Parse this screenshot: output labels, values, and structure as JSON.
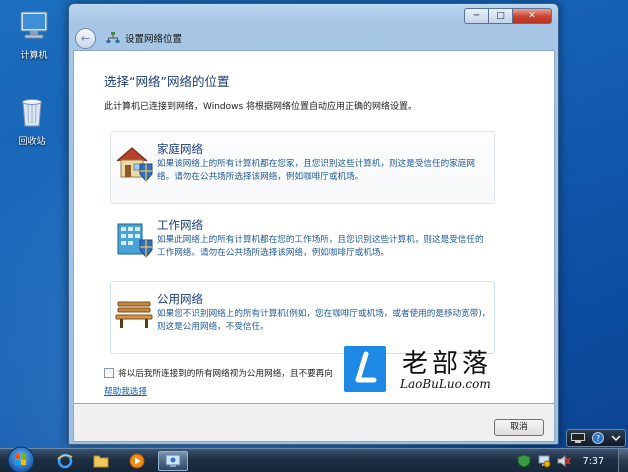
{
  "desktop": {
    "icons": [
      {
        "label": "计算机"
      },
      {
        "label": "回收站"
      }
    ]
  },
  "window": {
    "title": "设置网络位置",
    "controls": {
      "minimize": "─",
      "maximize": "□",
      "close": "✕"
    },
    "heading": "选择“网络”网络的位置",
    "description": "此计算机已连接到网络，Windows 将根据网络位置自动应用正确的网络设置。",
    "options": [
      {
        "title": "家庭网络",
        "description": "如果该网络上的所有计算机都在您家，且您识别这些计算机，则这是受信任的家庭网络。请勿在公共场所选择该网络，例如咖啡厅或机场。"
      },
      {
        "title": "工作网络",
        "description": "如果此网络上的所有计算机都在您的工作场所，且您识别这些计算机，则这是受信任的工作网络。请勿在公共场所选择该网络，例如咖啡厅或机场。"
      },
      {
        "title": "公用网络",
        "description": "如果您不识别网络上的所有计算机(例如，您在咖啡厅或机场，或者使用的是移动宽带)，则这是公用网络，不受信任。"
      }
    ],
    "checkbox_label": "将以后我所连接到的所有网络视为公用网络，且不要再向",
    "help_link": "帮助我选择",
    "cancel_label": "取消"
  },
  "watermark": {
    "logo_letter": "L",
    "chinese": "老部落",
    "english": "LaoBuLuo.com"
  },
  "taskbar": {
    "clock": "7:37",
    "colors": {
      "accent": "#1e88e5",
      "close": "#c9412f",
      "link": "#1a5fb4"
    }
  }
}
